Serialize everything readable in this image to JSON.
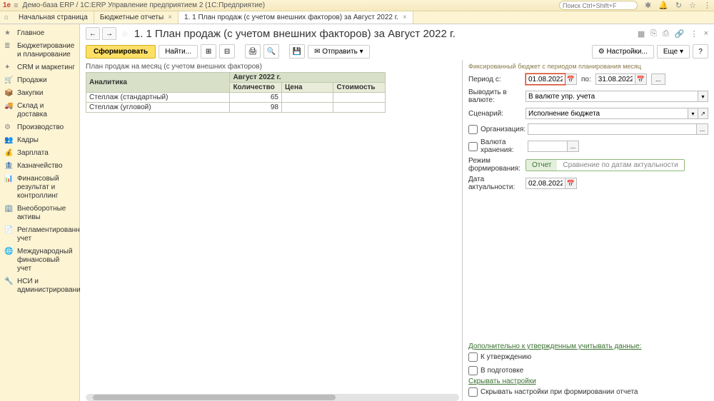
{
  "window": {
    "title": "Демо-база ERP / 1С:ERP Управление предприятием 2  (1С:Предприятие)",
    "search_placeholder": "Поиск Ctrl+Shift+F"
  },
  "tabs": {
    "t0": "Начальная страница",
    "t1": "Бюджетные отчеты",
    "t2": "1. 1 План продаж (с учетом внешних факторов) за Август 2022 г."
  },
  "sidebar": {
    "items": [
      "Главное",
      "Бюджетирование и планирование",
      "CRM и маркетинг",
      "Продажи",
      "Закупки",
      "Склад и доставка",
      "Производство",
      "Кадры",
      "Зарплата",
      "Казначейство",
      "Финансовый результат и контроллинг",
      "Внеоборотные активы",
      "Регламентированный учет",
      "Международный финансовый учет",
      "НСИ и администрирование"
    ]
  },
  "page": {
    "title": "1. 1 План продаж (с учетом внешних факторов) за Август 2022 г."
  },
  "toolbar": {
    "generate": "Сформировать",
    "find": "Найти...",
    "send": "Отправить",
    "settings": "Настройки...",
    "more": "Еще",
    "help": "?"
  },
  "report": {
    "desc": "План продаж на месяц (с учетом внешних факторов)",
    "col_analytics": "Аналитика",
    "period": "Август 2022 г.",
    "col_qty": "Количество",
    "col_price": "Цена",
    "col_cost": "Стоимость",
    "rows": [
      {
        "name": "Стеллаж (стандартный)",
        "qty": "65"
      },
      {
        "name": "Стеллаж (угловой)",
        "qty": "98"
      }
    ]
  },
  "settings": {
    "head": "Фиксированный бюджет с периодом планирования месяц",
    "period_from_lbl": "Период с:",
    "period_from": "01.08.2022",
    "period_to_lbl": "по:",
    "period_to": "31.08.2022",
    "currency_lbl": "Выводить в валюте:",
    "currency_val": "В валюте упр. учета",
    "scenario_lbl": "Сценарий:",
    "scenario_val": "Исполнение бюджета",
    "org_lbl": "Организация:",
    "valuta_lbl": "Валюта хранения:",
    "mode_lbl": "Режим формирования:",
    "mode_a": "Отчет",
    "mode_b": "Сравнение по датам актуальности",
    "actual_lbl": "Дата актуальности:",
    "actual_val": "02.08.2022",
    "extra_head": "Дополнительно к утвержденным учитывать данные:",
    "extra_a": "К утверждению",
    "extra_b": "В подготовке",
    "hide_head": "Скрывать настройки",
    "hide_a": "Скрывать настройки при формировании отчета"
  }
}
